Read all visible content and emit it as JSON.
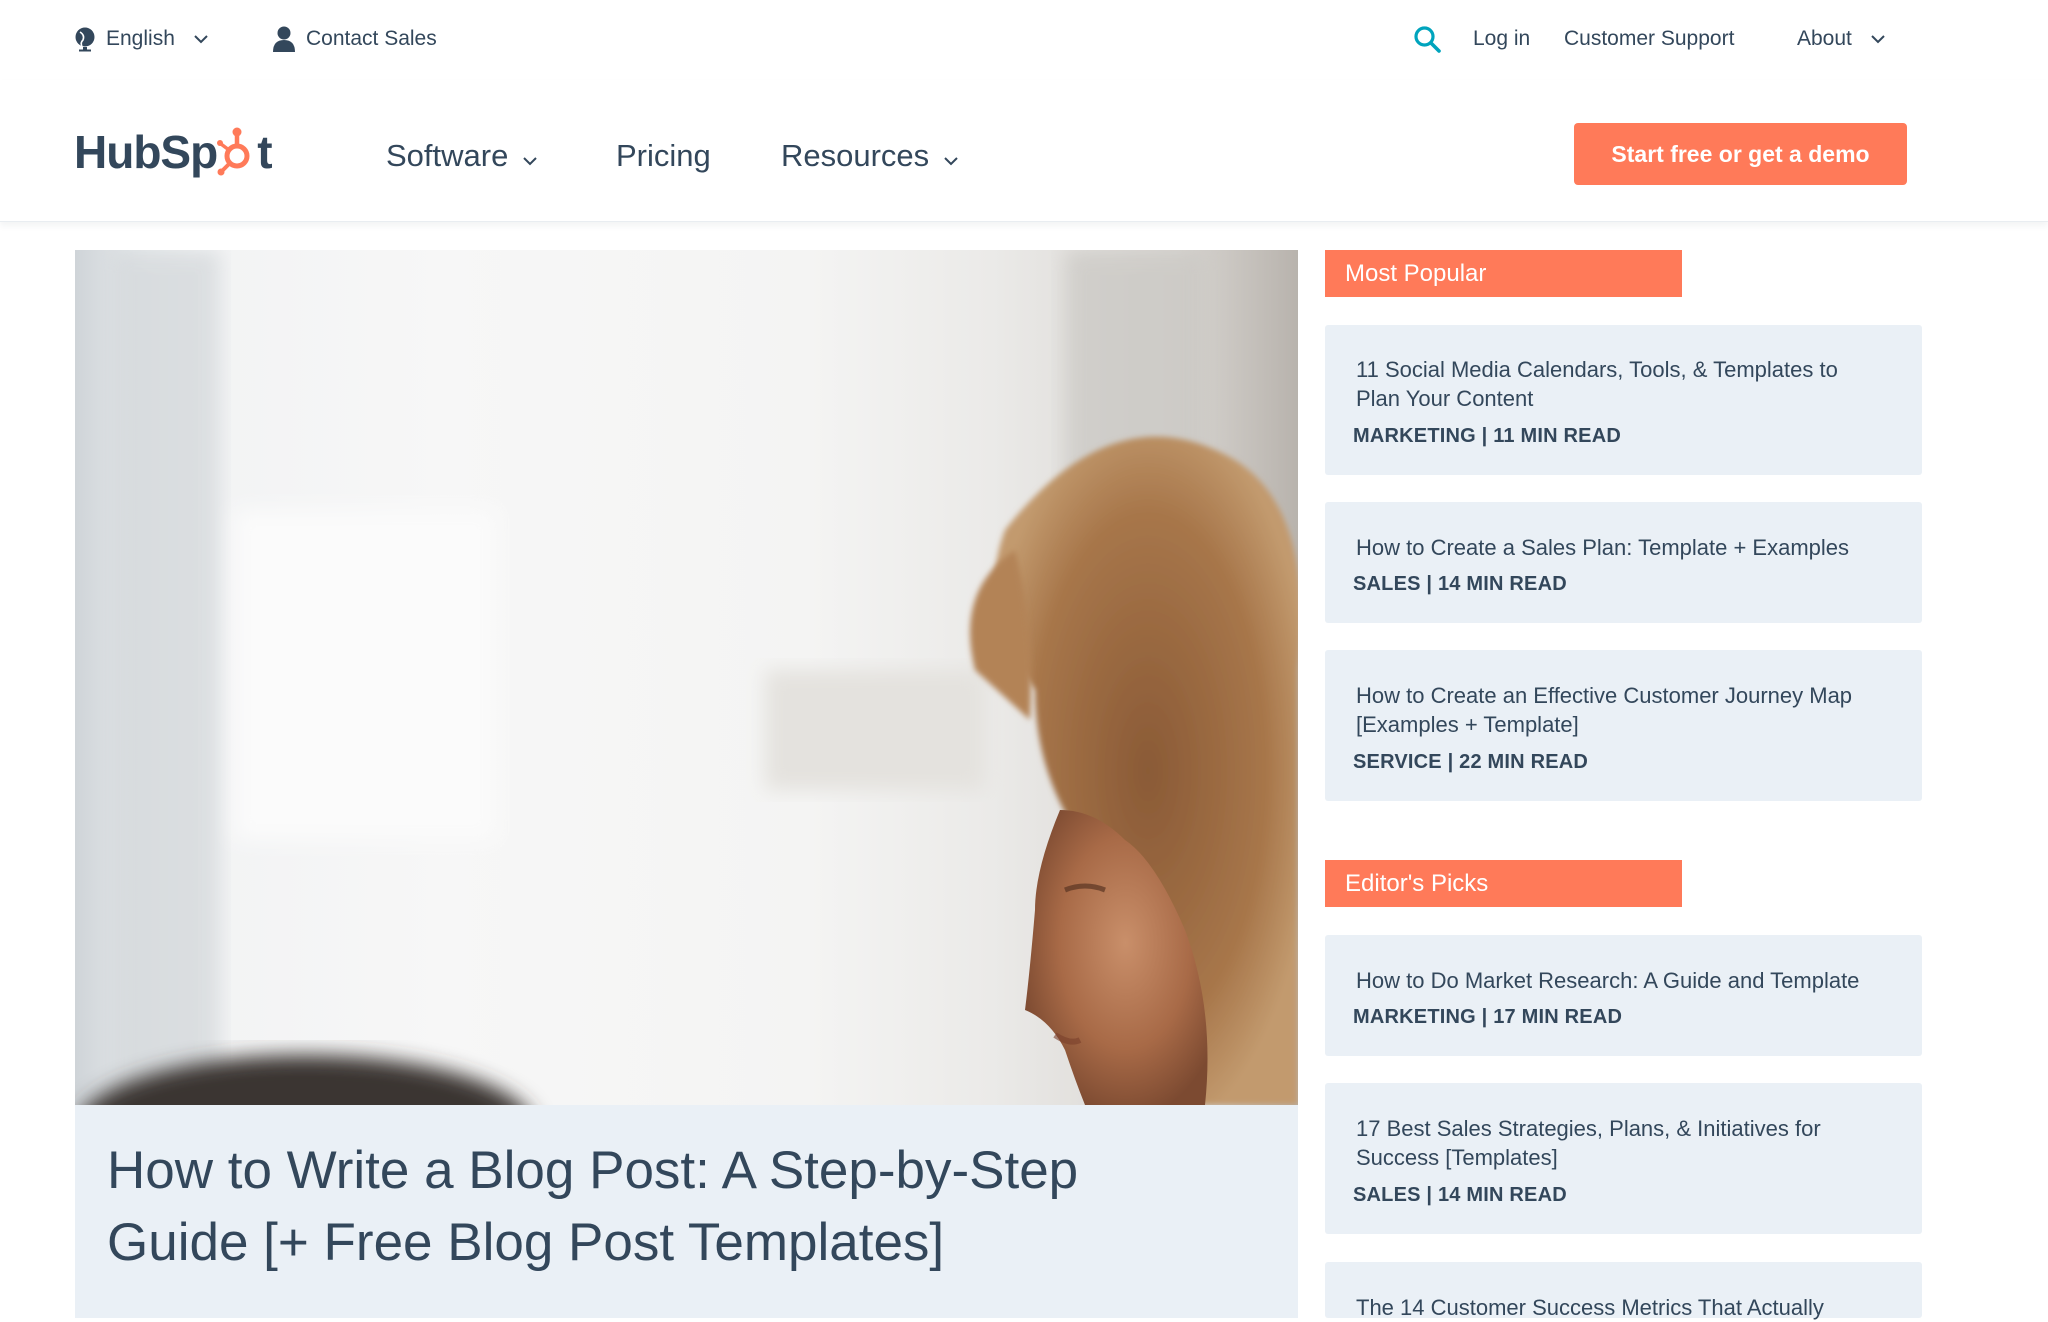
{
  "utility": {
    "language": "English",
    "contact_sales": "Contact Sales",
    "login": "Log in",
    "customer_support": "Customer Support",
    "about": "About"
  },
  "nav": {
    "logo_text_left": "HubSp",
    "logo_text_right": "t",
    "software": "Software",
    "pricing": "Pricing",
    "resources": "Resources",
    "cta": "Start free or get a demo"
  },
  "hero": {
    "title_line1": "How to Write a Blog Post: A Step-by-Step",
    "title_line2": "Guide [+ Free Blog Post Templates]"
  },
  "sidebar": {
    "most_popular_label": "Most Popular",
    "editors_picks_label": "Editor's Picks",
    "most_popular": [
      {
        "title_line1": "11 Social Media Calendars, Tools, & Templates to",
        "title_line2": "Plan Your Content",
        "meta": "MARKETING | 11 MIN READ"
      },
      {
        "title_line1": "How to Create a Sales Plan: Template + Examples",
        "title_line2": "",
        "meta": "SALES | 14 MIN READ"
      },
      {
        "title_line1": "How to Create an Effective Customer Journey Map",
        "title_line2": "[Examples + Template]",
        "meta": "SERVICE | 22 MIN READ"
      }
    ],
    "editors_picks": [
      {
        "title_line1": "How to Do Market Research: A Guide and Template",
        "title_line2": "",
        "meta": "MARKETING | 17 MIN READ"
      },
      {
        "title_line1": "17 Best Sales Strategies, Plans, & Initiatives for",
        "title_line2": "Success [Templates]",
        "meta": "SALES | 14 MIN READ"
      },
      {
        "title_line1": "The 14 Customer Success Metrics That Actually",
        "title_line2": "",
        "meta": ""
      }
    ]
  },
  "colors": {
    "brand_orange": "#ff7a59",
    "text_dark": "#33475b",
    "card_bg": "#eaf0f6",
    "search_teal": "#00a4bd"
  }
}
